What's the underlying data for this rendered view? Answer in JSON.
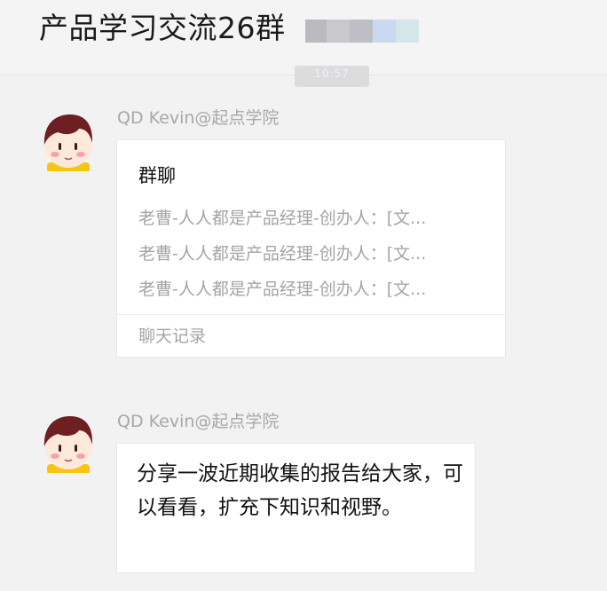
{
  "header": {
    "title": "产品学习交流26群",
    "redaction_colors": [
      "#b9babd",
      "#c9c9cc",
      "#bebfc6",
      "#cad9f0",
      "#d5e6ea"
    ]
  },
  "timestamp": "10:57",
  "messages": [
    {
      "sender": "QD Kevin@起点学院",
      "avatar_icon": "cartoon-boy-avatar-icon",
      "type": "chat-record-card",
      "card": {
        "title": "群聊",
        "lines": [
          "老曹-人人都是产品经理-创办人：[文...",
          "老曹-人人都是产品经理-创办人：[文...",
          "老曹-人人都是产品经理-创办人：[文..."
        ],
        "footer": "聊天记录"
      }
    },
    {
      "sender": "QD Kevin@起点学院",
      "avatar_icon": "cartoon-boy-avatar-icon",
      "type": "text",
      "text": "分享一波近期收集的报告给大家，可以看看，扩充下知识和视野。"
    }
  ]
}
